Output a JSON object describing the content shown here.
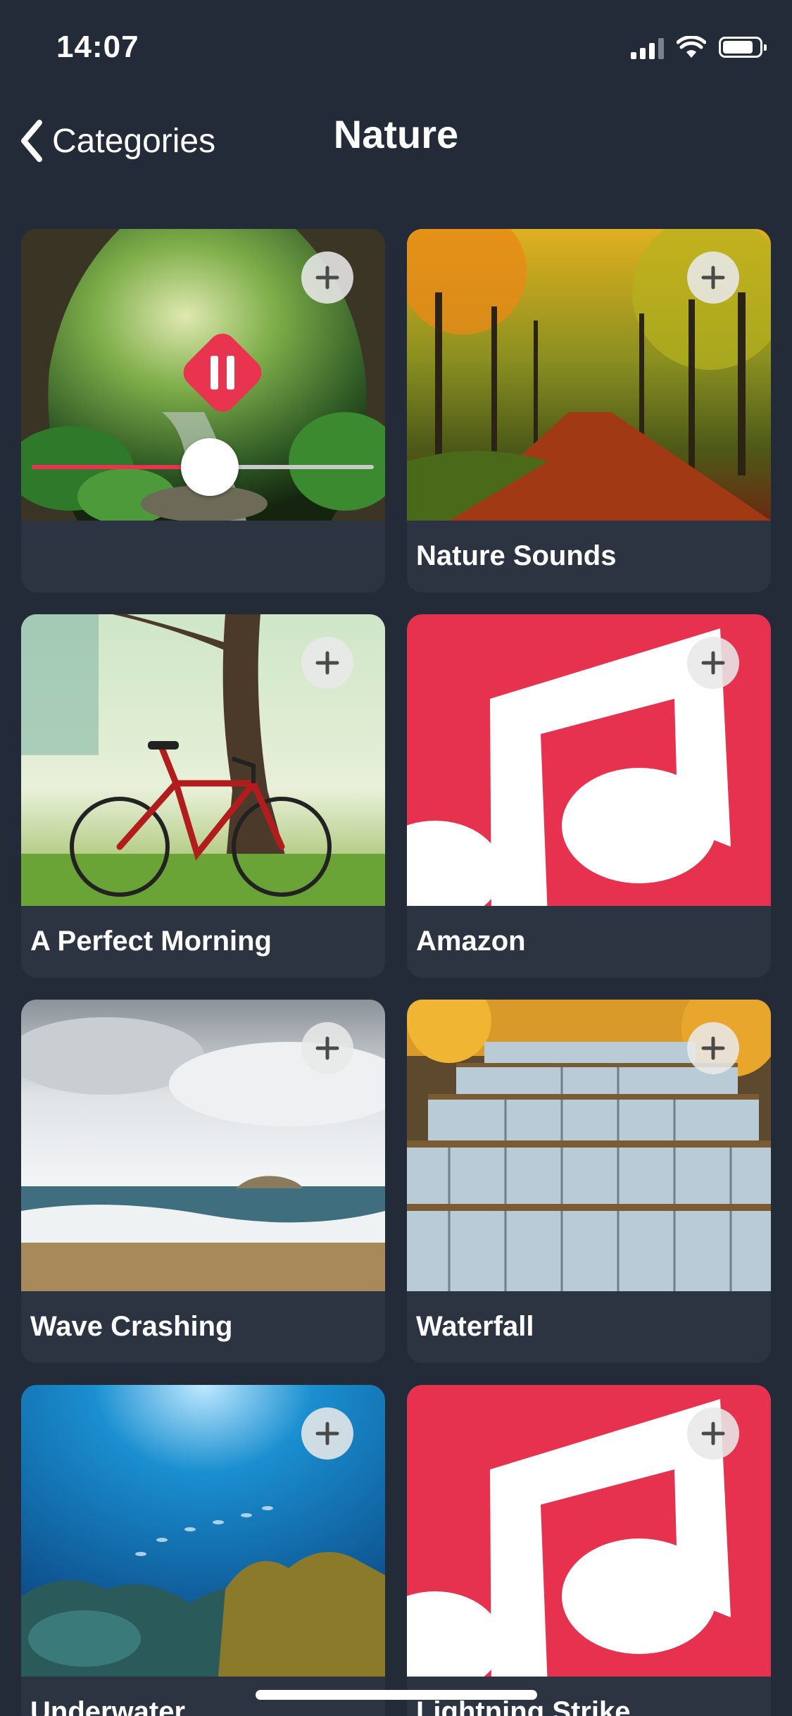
{
  "status_bar": {
    "time": "14:07"
  },
  "nav": {
    "back_label": "Categories",
    "title": "Nature"
  },
  "now_playing": {
    "progress": 0.52
  },
  "grid": {
    "items": [
      {
        "label": ""
      },
      {
        "label": "Nature Sounds"
      },
      {
        "label": "A Perfect Morning"
      },
      {
        "label": "Amazon"
      },
      {
        "label": "Wave Crashing"
      },
      {
        "label": "Waterfall"
      },
      {
        "label": "Underwater"
      },
      {
        "label": "Lightning Strike"
      }
    ]
  },
  "colors": {
    "background": "#232b38",
    "card": "#2c3442",
    "accent": "#e8344f",
    "placeholder_art": "#e6324f"
  },
  "icons": {
    "back": "chevron-left-icon",
    "add": "plus-icon",
    "pause": "pause-icon",
    "placeholder": "music-note-icon"
  }
}
